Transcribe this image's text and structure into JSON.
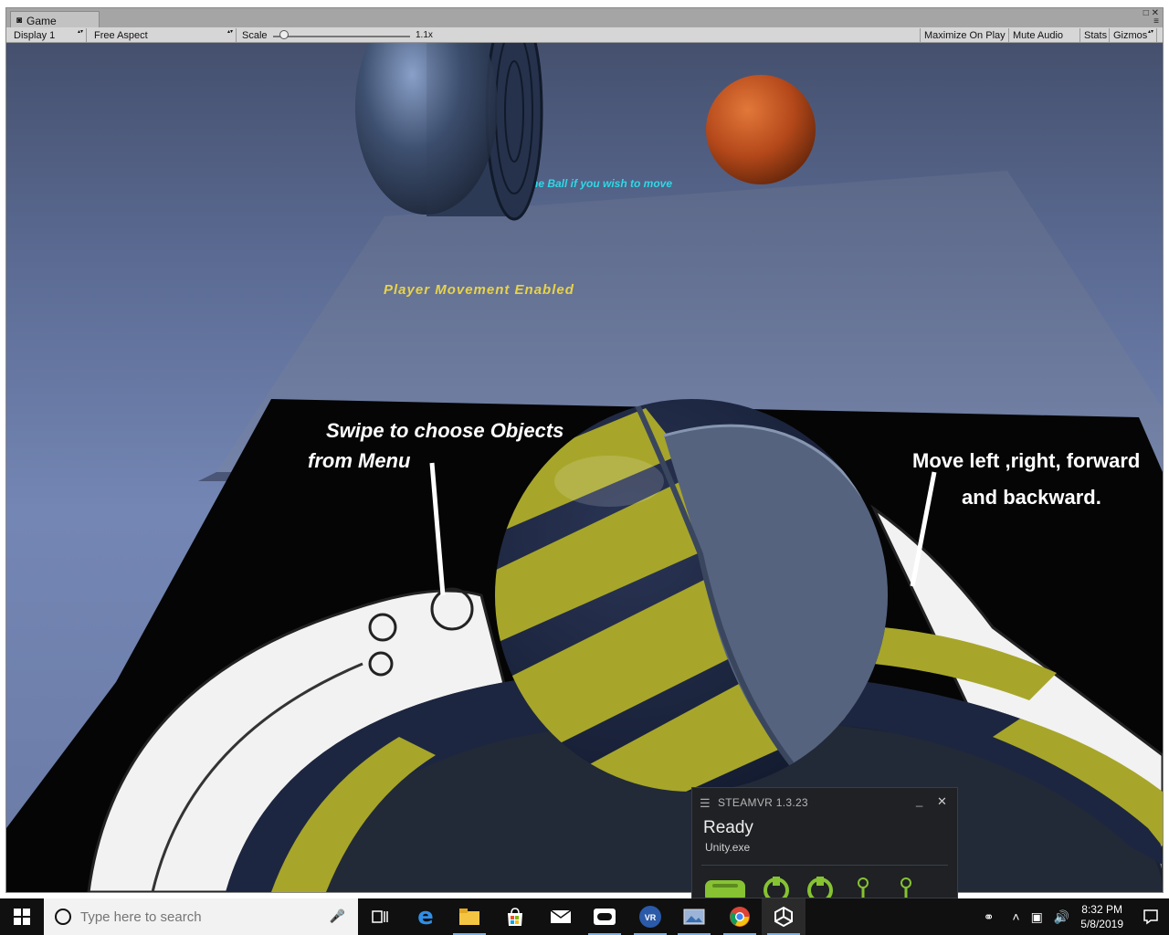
{
  "window": {
    "tab_label": "Game",
    "tab_icon": "pacman-icon"
  },
  "toolbar": {
    "display": "Display 1",
    "aspect": "Free Aspect",
    "scale_label": "Scale",
    "scale_value": "1.1x",
    "scale_fraction": 0.06,
    "maximize_on_play": "Maximize On Play",
    "mute_audio": "Mute Audio",
    "stats": "Stats",
    "gizmos": "Gizmos"
  },
  "scene": {
    "instruction_partial": "he Ball if you wish to move",
    "status_text": "Player Movement Enabled",
    "callout_left": [
      "Swipe to choose Objects",
      "from Menu"
    ],
    "callout_right": [
      "Move left ,right, forward",
      "and backward."
    ],
    "colors": {
      "instruction": "#2fd8e6",
      "status": "#e8d34a",
      "ball_orange": "#c2501c",
      "stripe_yellow": "#a7a62a",
      "stripe_navy": "#1d2640"
    }
  },
  "steamvr": {
    "title": "STEAMVR 1.3.23",
    "status": "Ready",
    "app": "Unity.exe",
    "accent": "#86c232"
  },
  "taskbar": {
    "search_placeholder": "Type here to search",
    "time": "8:32 PM",
    "date": "5/8/2019",
    "apps": [
      "task-view-icon",
      "edge-icon",
      "file-explorer-icon",
      "store-icon",
      "mail-icon",
      "oculus-icon",
      "vr-icon",
      "photos-icon",
      "chrome-icon",
      "unity-icon"
    ]
  }
}
